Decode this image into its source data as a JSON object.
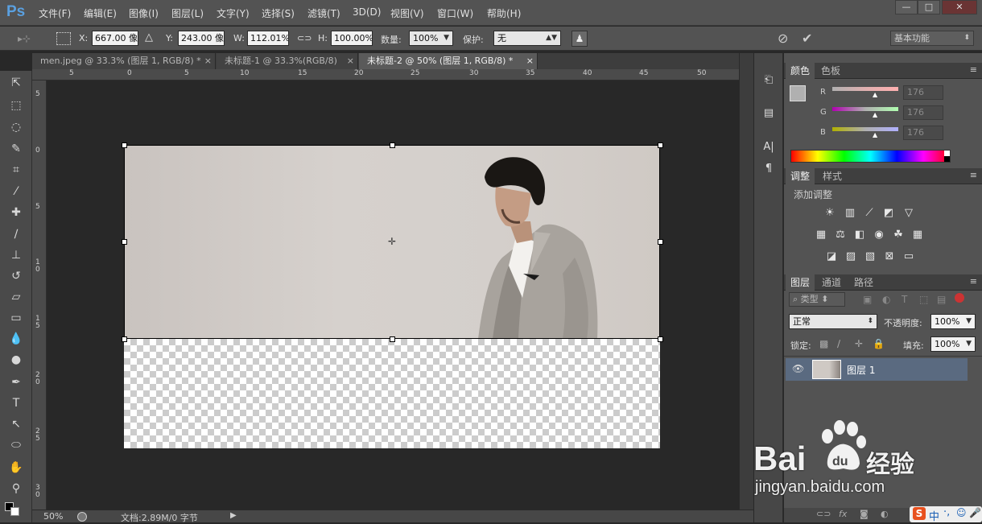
{
  "app": {
    "logo": "Ps"
  },
  "menu": [
    "文件(F)",
    "编辑(E)",
    "图像(I)",
    "图层(L)",
    "文字(Y)",
    "选择(S)",
    "滤镜(T)",
    "3D(D)",
    "视图(V)",
    "窗口(W)",
    "帮助(H)"
  ],
  "window_controls": {
    "minimize": "—",
    "maximize": "□",
    "close": "✕"
  },
  "options": {
    "x_label": "X:",
    "x_value": "667.00 像",
    "y_label": "Y:",
    "y_value": "243.00 像",
    "w_label": "W:",
    "w_value": "112.01%",
    "h_label": "H:",
    "h_value": "100.00%",
    "amount_label": "数量:",
    "amount_value": "100%",
    "protect_label": "保护:",
    "protect_value": "无",
    "workspace": "基本功能"
  },
  "tabs": [
    {
      "label": "men.jpeg @ 33.3% (图层 1, RGB/8) *",
      "close": "×"
    },
    {
      "label": "未标题-1 @ 33.3%(RGB/8)",
      "close": "×"
    },
    {
      "label": "未标题-2 @ 50% (图层 1, RGB/8) *",
      "close": "×"
    }
  ],
  "ruler_top": [
    "5",
    "0",
    "5",
    "10",
    "15",
    "20",
    "25",
    "30",
    "35",
    "40",
    "45",
    "50"
  ],
  "ruler_left": [
    "5",
    "0",
    "5",
    "1\n0",
    "1\n5",
    "2\n0",
    "2\n5",
    "3\n0"
  ],
  "status": {
    "zoom": "50%",
    "doc": "文档:2.89M/0 字节"
  },
  "color_panel": {
    "tabs": [
      "颜色",
      "色板"
    ],
    "r_label": "R",
    "r_value": "176",
    "g_label": "G",
    "g_value": "176",
    "b_label": "B",
    "b_value": "176",
    "fg_color": "#b0b0b0"
  },
  "adjust_panel": {
    "tabs": [
      "调整",
      "样式"
    ],
    "title": "添加调整"
  },
  "layers_panel": {
    "tabs": [
      "图层",
      "通道",
      "路径"
    ],
    "filter": "类型",
    "blend_mode": "正常",
    "opacity_label": "不透明度:",
    "opacity_value": "100%",
    "lock_label": "锁定:",
    "fill_label": "填充:",
    "fill_value": "100%",
    "layer_name": "图层 1"
  },
  "watermark": {
    "brand": "Bai",
    "brand2": "经验",
    "url": "jingyan.baidu.com"
  },
  "ime": {
    "lang": "中"
  }
}
